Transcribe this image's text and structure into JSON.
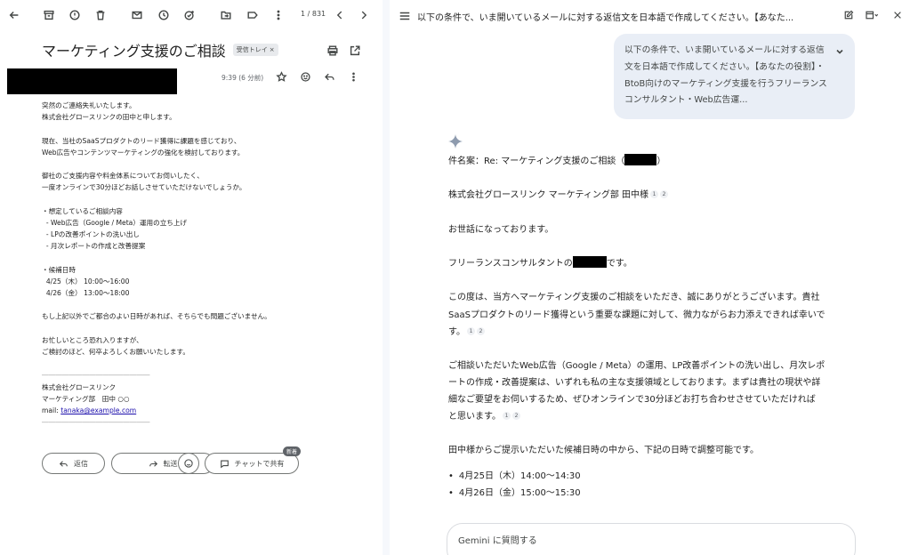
{
  "gmail": {
    "counter": "1 / 831",
    "subject": "マーケティング支援のご相談",
    "label_chip": "受信トレイ",
    "label_close": "×",
    "time": "9:39 (6 分前)",
    "body_lines": [
      "突然のご連絡失礼いたします。",
      "株式会社グロースリンクの田中と申します。",
      "",
      "現在、当社のSaaSプロダクトのリード獲得に課題を感じており、",
      "Web広告やコンテンツマーケティングの強化を検討しております。",
      "",
      "御社のご支援内容や料金体系についてお伺いしたく、",
      "一度オンラインで30分ほどお話しさせていただけないでしょうか。",
      "",
      "・想定しているご相談内容",
      "  - Web広告（Google / Meta）運用の立ち上げ",
      "  - LPの改善ポイントの洗い出し",
      "  - 月次レポートの作成と改善提案",
      "",
      "・候補日時",
      "  4/25（木） 10:00〜16:00",
      "  4/26（金） 13:00〜18:00",
      "",
      "もし上記以外でご都合のよい日時があれば、そちらでも問題ございません。",
      "",
      "お忙しいところ恐れ入りますが、",
      "ご検討のほど、何卒よろしくお願いいたします。",
      "",
      "――――――――――――――――",
      "株式会社グロースリンク",
      "マーケティング部　田中 ○○"
    ],
    "mail_label": "mail: ",
    "mail_address": "tanaka@example.com",
    "sig_end": "――――――――――――――――",
    "reply_label": "返信",
    "forward_label": "転送",
    "chat_share_label": "チャットで共有",
    "new_badge": "新着"
  },
  "gemini": {
    "header_title": "以下の条件で、いま開いているメールに対する返信文を日本語で作成してください。【あなた...",
    "user_prompt": "以下の条件で、いま開いているメールに対する返信文を日本語で作成してください。【あなたの役割】・BtoB向けのマーケティング支援を行うフリーランスコンサルタント・Web広告運...",
    "subject_line_prefix": "件名案：Re: マーケティング支援のご相談（",
    "subject_line_suffix": "）",
    "addressee": "株式会社グロースリンク マーケティング部 田中様",
    "greeting": "お世話になっております。",
    "self_intro_prefix": "フリーランスコンサルタントの",
    "self_intro_suffix": "です。",
    "para1_l1": "この度は、当方へマーケティング支援のご相談をいただき、誠にありがとうございます。貴社",
    "para1_l2": "SaaSプロダクトのリード獲得という重要な課題に対して、微力ながらお力添えできれば幸いで",
    "para1_l3": "す。",
    "para2_l1": "ご相談いただいたWeb広告（Google / Meta）の運用、LP改善ポイントの洗い出し、月次レポ",
    "para2_l2": "ートの作成・改善提案は、いずれも私の主な支援領域としております。まずは貴社の現状や詳",
    "para2_l3": "細なご要望をお伺いするため、ぜひオンラインで30分ほどお打ち合わせさせていただければ",
    "para2_l4": "と思います。",
    "para3": "田中様からご提示いただいた候補日時の中から、下記の日時で調整可能です。",
    "slots": [
      "4月25日（木）14:00〜14:30",
      "4月26日（金）15:00〜15:30"
    ],
    "cite_1": "1",
    "cite_2": "2",
    "ask_placeholder": "Gemini に質問する"
  }
}
